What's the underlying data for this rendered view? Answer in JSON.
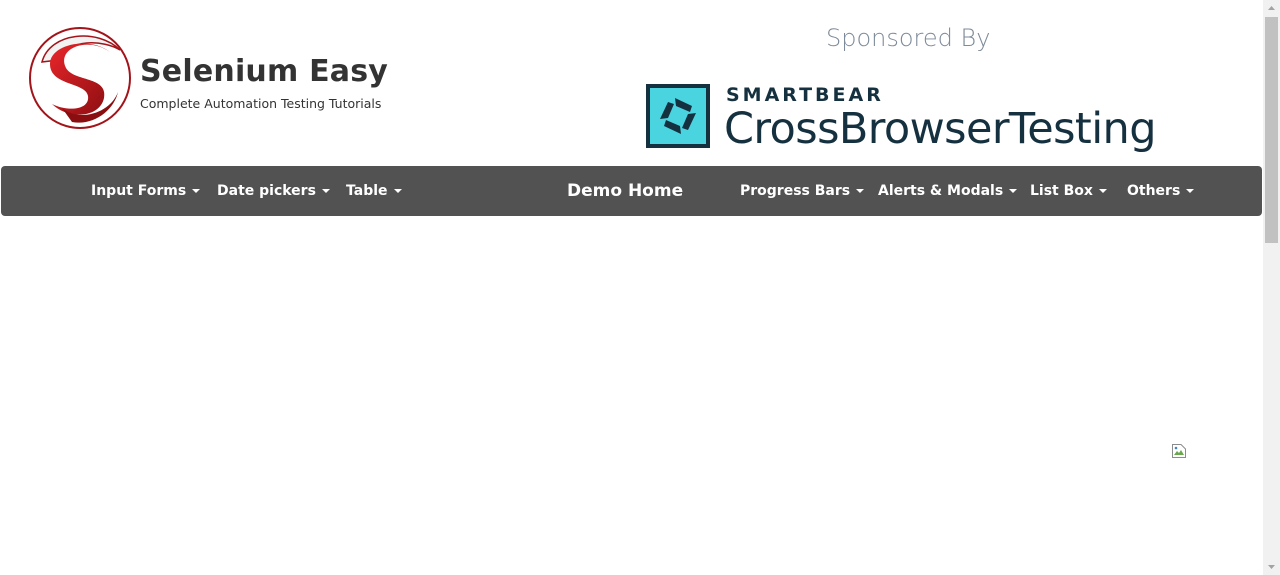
{
  "header": {
    "site_name": "Selenium Easy",
    "tagline": "Complete Automation Testing Tutorials",
    "logo_icon": "selenium-easy-logo",
    "sponsored_label": "Sponsored By",
    "sponsor_company": "SMARTBEAR",
    "sponsor_product": "CrossBrowserTesting",
    "sponsor_icon": "crossbrowsertesting-logo"
  },
  "nav": {
    "items_left": [
      {
        "label": "Input Forms"
      },
      {
        "label": "Date pickers"
      },
      {
        "label": "Table"
      }
    ],
    "home": "Demo Home",
    "items_right": [
      {
        "label": "Progress Bars"
      },
      {
        "label": "Alerts & Modals"
      },
      {
        "label": "List Box"
      },
      {
        "label": "Others"
      }
    ]
  },
  "colors": {
    "navbar": "#525252",
    "brand_red": "#c0141b",
    "sponsor_teal": "#4ad4e0",
    "sponsor_navy": "#15303f"
  },
  "content": {
    "broken_image_icon": "broken-image-icon"
  }
}
